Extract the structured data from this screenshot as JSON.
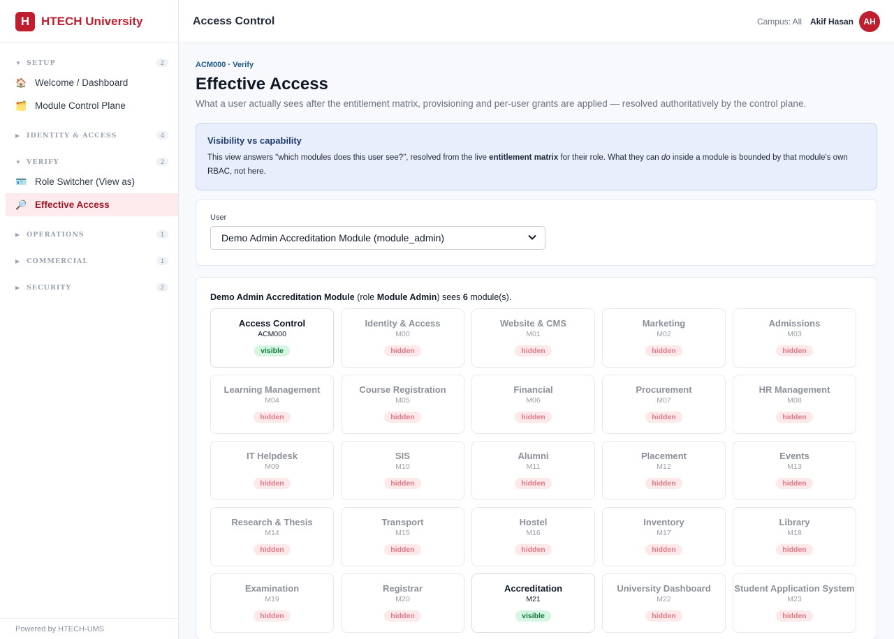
{
  "brand": {
    "logo_letter": "H",
    "name": "HTECH University",
    "color": "#be1e2d"
  },
  "sidebar": {
    "sections": [
      {
        "label": "SETUP",
        "count": "2",
        "expanded": true,
        "items": [
          {
            "label": "Welcome / Dashboard",
            "icon": "house-icon",
            "glyph": "🏠"
          },
          {
            "label": "Module Control Plane",
            "icon": "folder-icon",
            "glyph": "🗂️"
          }
        ]
      },
      {
        "label": "IDENTITY & ACCESS",
        "count": "4",
        "expanded": false,
        "items": []
      },
      {
        "label": "VERIFY",
        "count": "2",
        "expanded": true,
        "items": [
          {
            "label": "Role Switcher (View as)",
            "icon": "id-card-icon",
            "glyph": "🪪"
          },
          {
            "label": "Effective Access",
            "icon": "magnifier-icon",
            "glyph": "🔎",
            "active": true
          }
        ]
      },
      {
        "label": "OPERATIONS",
        "count": "1",
        "expanded": false,
        "items": []
      },
      {
        "label": "COMMERCIAL",
        "count": "1",
        "expanded": false,
        "items": []
      },
      {
        "label": "SECURITY",
        "count": "2",
        "expanded": false,
        "items": []
      }
    ],
    "footer": "Powered by HTECH-UMS"
  },
  "header": {
    "title": "Access Control",
    "campus": "Campus: All",
    "user_name": "Akif Hasan",
    "avatar_initials": "AH"
  },
  "page": {
    "eyebrow": "ACM000 · Verify",
    "title": "Effective Access",
    "subtitle": "What a user actually sees after the entitlement matrix, provisioning and per-user grants are applied — resolved authoritatively by the control plane."
  },
  "info": {
    "title": "Visibility vs capability",
    "text_1": "This view answers \"which modules does this user see?\", resolved from the live ",
    "text_bold": "entitlement matrix",
    "text_2": " for their role. What they can ",
    "text_italic": "do",
    "text_3": " inside a module is bounded by that module's own RBAC, not here."
  },
  "user_select": {
    "label": "User",
    "value": "Demo Admin Accreditation Module (module_admin)"
  },
  "summary": {
    "user": "Demo Admin Accreditation Module",
    "pre_role": " (role ",
    "role": "Module Admin",
    "mid": ") sees ",
    "count": "6",
    "post": " module(s)."
  },
  "badges": {
    "visible": "visible",
    "hidden": "hidden"
  },
  "modules": [
    {
      "name": "Access Control",
      "code": "ACM000",
      "visible": true
    },
    {
      "name": "Identity & Access",
      "code": "M00",
      "visible": false
    },
    {
      "name": "Website & CMS",
      "code": "M01",
      "visible": false
    },
    {
      "name": "Marketing",
      "code": "M02",
      "visible": false
    },
    {
      "name": "Admissions",
      "code": "M03",
      "visible": false
    },
    {
      "name": "Learning Management",
      "code": "M04",
      "visible": false
    },
    {
      "name": "Course Registration",
      "code": "M05",
      "visible": false
    },
    {
      "name": "Financial",
      "code": "M06",
      "visible": false
    },
    {
      "name": "Procurement",
      "code": "M07",
      "visible": false
    },
    {
      "name": "HR Management",
      "code": "M08",
      "visible": false
    },
    {
      "name": "IT Helpdesk",
      "code": "M09",
      "visible": false
    },
    {
      "name": "SIS",
      "code": "M10",
      "visible": false
    },
    {
      "name": "Alumni",
      "code": "M11",
      "visible": false
    },
    {
      "name": "Placement",
      "code": "M12",
      "visible": false
    },
    {
      "name": "Events",
      "code": "M13",
      "visible": false
    },
    {
      "name": "Research & Thesis",
      "code": "M14",
      "visible": false
    },
    {
      "name": "Transport",
      "code": "M15",
      "visible": false
    },
    {
      "name": "Hostel",
      "code": "M16",
      "visible": false
    },
    {
      "name": "Inventory",
      "code": "M17",
      "visible": false
    },
    {
      "name": "Library",
      "code": "M18",
      "visible": false
    },
    {
      "name": "Examination",
      "code": "M19",
      "visible": false
    },
    {
      "name": "Registrar",
      "code": "M20",
      "visible": false
    },
    {
      "name": "Accreditation",
      "code": "M21",
      "visible": true
    },
    {
      "name": "University Dashboard",
      "code": "M22",
      "visible": false
    },
    {
      "name": "Student Application System",
      "code": "M23",
      "visible": false
    }
  ]
}
